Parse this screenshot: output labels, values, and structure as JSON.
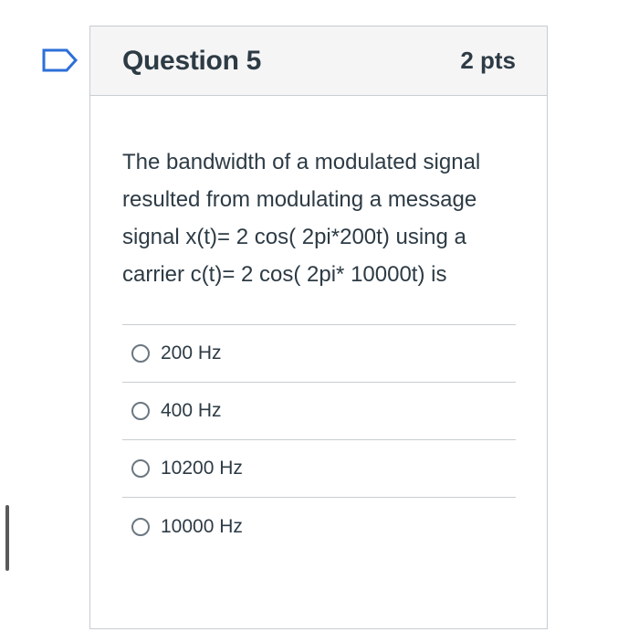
{
  "question": {
    "title": "Question 5",
    "points": "2 pts",
    "text": "The bandwidth of a modulated signal  resulted from modulating a message signal x(t)= 2 cos( 2pi*200t) using a carrier c(t)= 2 cos( 2pi* 10000t)  is",
    "flag_icon": "flag-outline-icon"
  },
  "answers": [
    {
      "label": "200 Hz"
    },
    {
      "label": "400 Hz"
    },
    {
      "label": "10200 Hz"
    },
    {
      "label": "10000 Hz"
    }
  ],
  "colors": {
    "flag": "#2d6fd8",
    "text": "#2d3b45",
    "border": "#c7cdd1",
    "header_bg": "#f5f5f5"
  }
}
